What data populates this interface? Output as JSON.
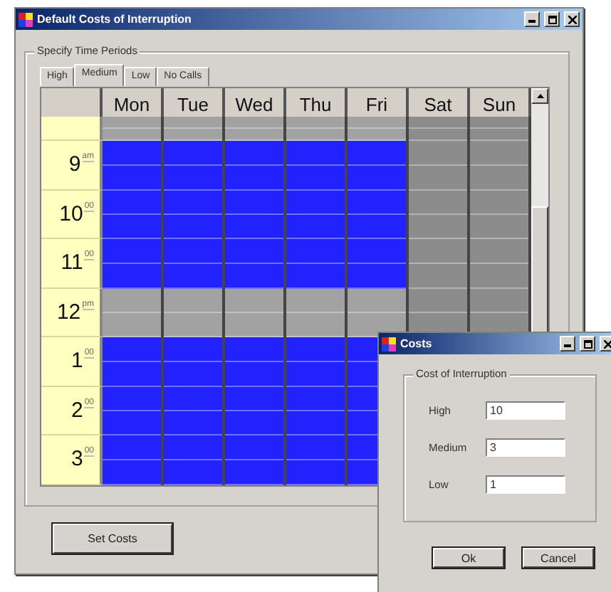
{
  "main_window": {
    "title": "Default Costs of Interruption",
    "group_title": "Specify Time Periods",
    "tabs": [
      {
        "label": "High",
        "selected": false
      },
      {
        "label": "Medium",
        "selected": true
      },
      {
        "label": "Low",
        "selected": false
      },
      {
        "label": "No Calls",
        "selected": false
      }
    ],
    "columns": [
      {
        "label": "Mon",
        "kind": "weekday"
      },
      {
        "label": "Tue",
        "kind": "weekday"
      },
      {
        "label": "Wed",
        "kind": "weekday"
      },
      {
        "label": "Thu",
        "kind": "weekday"
      },
      {
        "label": "Fri",
        "kind": "weekday"
      },
      {
        "label": "Sat",
        "kind": "weekend"
      },
      {
        "label": "Sun",
        "kind": "weekend"
      }
    ],
    "rows": [
      {
        "kind": "partial",
        "slots": [
          false,
          false,
          false,
          false,
          false,
          false,
          false
        ]
      },
      {
        "kind": "hour",
        "hour": "9",
        "suffix": "am",
        "slots": [
          true,
          true,
          true,
          true,
          true,
          false,
          false
        ]
      },
      {
        "kind": "hour",
        "hour": "10",
        "suffix": "00",
        "slots": [
          true,
          true,
          true,
          true,
          true,
          false,
          false
        ]
      },
      {
        "kind": "hour",
        "hour": "11",
        "suffix": "00",
        "slots": [
          true,
          true,
          true,
          true,
          true,
          false,
          false
        ]
      },
      {
        "kind": "hour",
        "hour": "12",
        "suffix": "pm",
        "slots": [
          false,
          false,
          false,
          false,
          false,
          false,
          false
        ]
      },
      {
        "kind": "hour",
        "hour": "1",
        "suffix": "00",
        "slots": [
          true,
          true,
          true,
          true,
          true
        ]
      },
      {
        "kind": "hour",
        "hour": "2",
        "suffix": "00",
        "slots": [
          true,
          true,
          true,
          true,
          true
        ]
      },
      {
        "kind": "hour",
        "hour": "3",
        "suffix": "00",
        "slots": [
          true,
          true,
          true,
          true,
          true
        ]
      }
    ],
    "button": "Set Costs"
  },
  "costs_dialog": {
    "title": "Costs",
    "group_title": "Cost of Interruption",
    "fields": [
      {
        "label": "High",
        "value": "10"
      },
      {
        "label": "Medium",
        "value": "3"
      },
      {
        "label": "Low",
        "value": "1"
      }
    ],
    "buttons": [
      "Ok",
      "Cancel"
    ]
  }
}
